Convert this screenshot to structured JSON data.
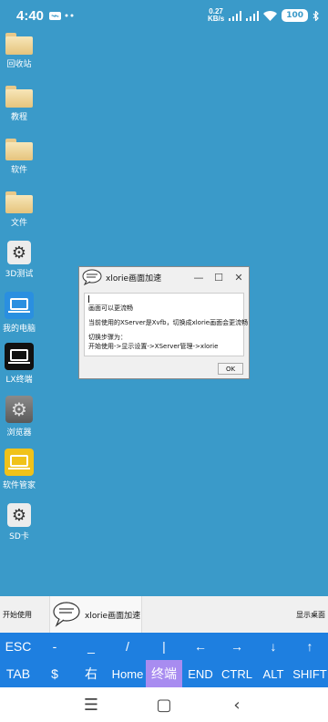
{
  "statusbar": {
    "time": "4:40",
    "net_speed_value": "0.27",
    "net_speed_unit": "KB/s",
    "battery": "100"
  },
  "desktop_icons": [
    {
      "label": "回收站",
      "type": "folder"
    },
    {
      "label": "教程",
      "type": "folder"
    },
    {
      "label": "软件",
      "type": "folder"
    },
    {
      "label": "文件",
      "type": "folder"
    },
    {
      "label": "3D测试",
      "type": "gear"
    },
    {
      "label": "我的电脑",
      "type": "laptop-blue"
    },
    {
      "label": "LX终端",
      "type": "laptop-black"
    },
    {
      "label": "浏览器",
      "type": "gear-gray"
    },
    {
      "label": "软件管家",
      "type": "laptop-yellow"
    },
    {
      "label": "SD卡",
      "type": "gear"
    }
  ],
  "dialog": {
    "title": "xlorie画面加速",
    "line1": "画面可以更流畅",
    "line2": "当前使用的XServer是Xvfb，切换成xlorie画面会更流畅",
    "line3": "切换步骤为：",
    "line4": "开始使用->显示设置->XServer管理->xlorie",
    "ok_label": "OK",
    "minimize_glyph": "—",
    "maximize_glyph": "☐",
    "close_glyph": "✕"
  },
  "taskbar": {
    "start_label": "开始使用",
    "task_label": "xlorie画面加速",
    "show_desktop_label": "显示桌面"
  },
  "extra_keys": {
    "row1": [
      "ESC",
      "-",
      "_",
      "/",
      "|",
      "←",
      "→",
      "↓",
      "↑"
    ],
    "row2": [
      "TAB",
      "$",
      "右",
      "Home",
      "终端",
      "END",
      "CTRL",
      "ALT",
      "SHIFT"
    ],
    "active": "终端"
  },
  "navbar": {
    "recents_glyph": "☰",
    "home_glyph": "▢",
    "back_glyph": "‹"
  },
  "colors": {
    "desktop_bg": "#3a9ac9",
    "keys_bg": "#1e7fe0",
    "active_key": "#a88cf0"
  }
}
